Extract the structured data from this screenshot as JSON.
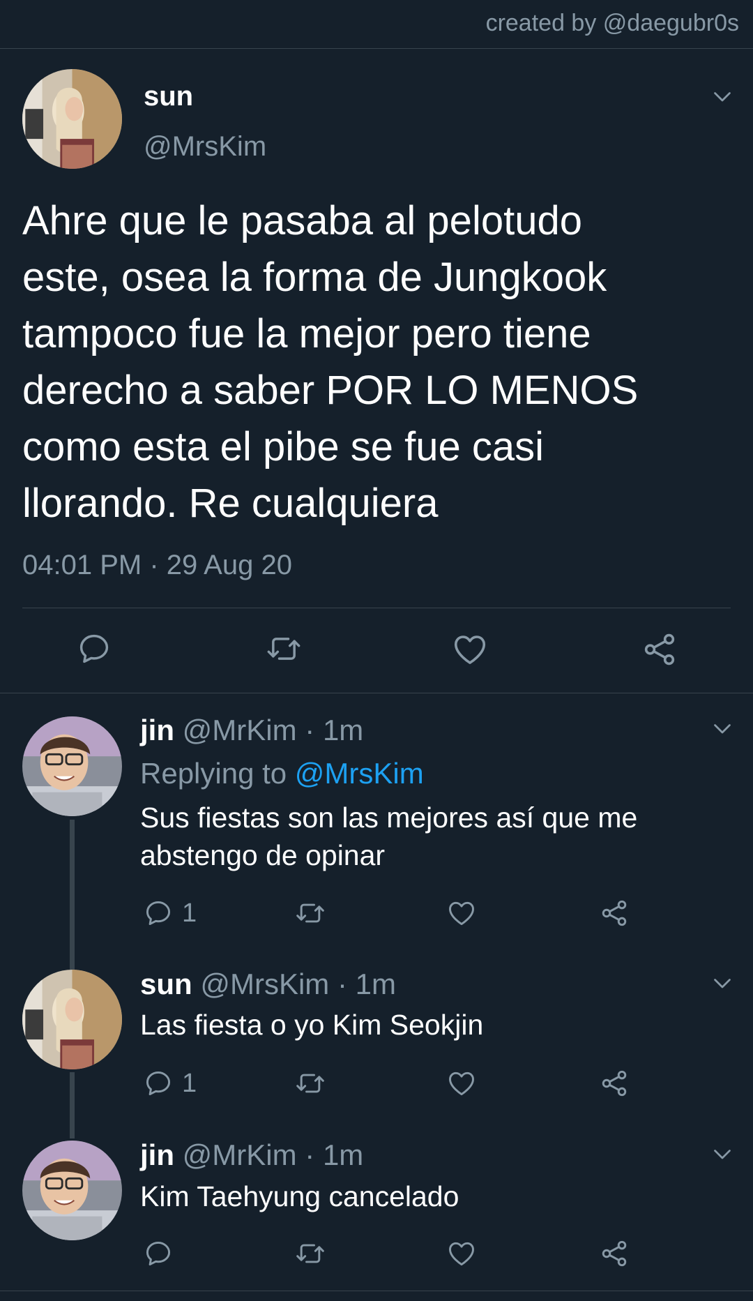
{
  "credit": "created by @daegubr0s",
  "main_tweet": {
    "name": "sun",
    "handle": "@MrsKim",
    "text": "Ahre que le pasaba al pelotudo\neste, osea la forma de Jungkook\ntampoco fue la mejor pero tiene\nderecho a saber POR LO MENOS\ncomo esta el pibe se fue casi\nllorando. Re cualquiera",
    "timestamp": "04:01 PM · 29 Aug 20",
    "actions": [
      "reply-icon",
      "retweet-icon",
      "like-icon",
      "share-icon"
    ]
  },
  "replies": [
    {
      "name": "jin",
      "handle": "@MrKim",
      "sep": " · ",
      "time": "1m",
      "replying_label": "Replying to ",
      "replying_to": "@MrsKim",
      "text": "Sus fiestas son las mejores así que me\nabstengo de opinar",
      "reply_count": "1"
    },
    {
      "name": "sun",
      "handle": "@MrsKim",
      "sep": " · ",
      "time": "1m",
      "text": "Las fiesta o yo Kim Seokjin",
      "reply_count": "1"
    },
    {
      "name": "jin",
      "handle": "@MrKim",
      "sep": " · ",
      "time": "1m",
      "text": "Kim Taehyung cancelado",
      "reply_count": ""
    }
  ],
  "colors": {
    "background": "#15202b",
    "text": "#ffffff",
    "secondary": "#8899a6",
    "link": "#1da1f2",
    "divider": "#38444d"
  }
}
